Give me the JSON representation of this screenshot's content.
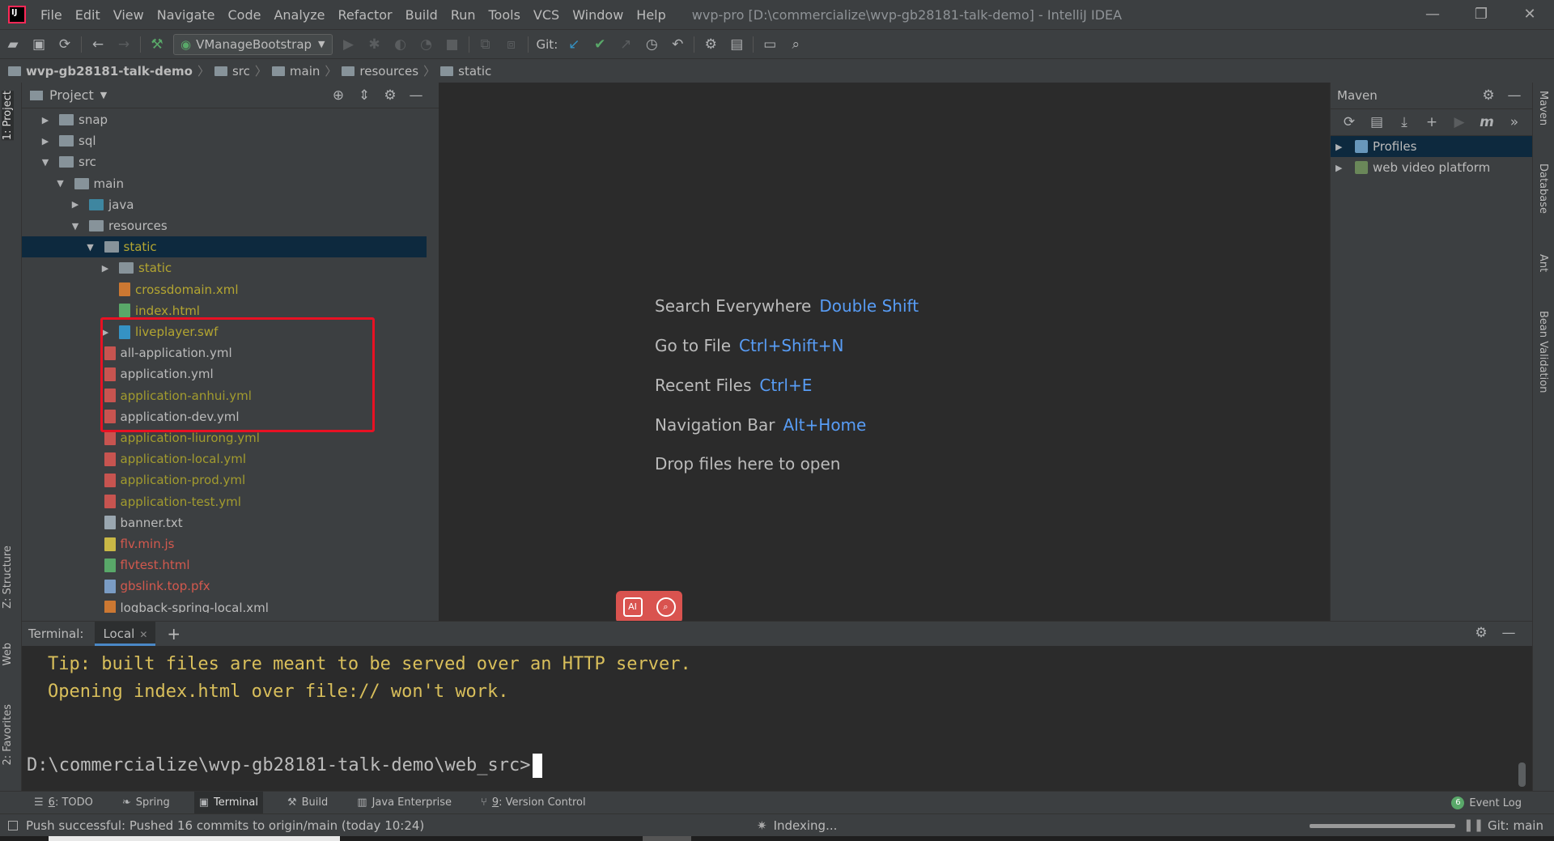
{
  "menubar": {
    "items": [
      "File",
      "Edit",
      "View",
      "Navigate",
      "Code",
      "Analyze",
      "Refactor",
      "Build",
      "Run",
      "Tools",
      "VCS",
      "Window",
      "Help"
    ],
    "title": "wvp-pro [D:\\commercialize\\wvp-gb28181-talk-demo] - IntelliJ IDEA",
    "window_controls": [
      "—",
      "❐",
      "✕"
    ]
  },
  "toolbar": {
    "run_config": "VManageBootstrap",
    "git_label": "Git:"
  },
  "breadcrumb": [
    "wvp-gb28181-talk-demo",
    "src",
    "main",
    "resources",
    "static"
  ],
  "left_strip": {
    "project_tab": "1: Project",
    "structure_tab": "Z: Structure",
    "web_tab": "Web",
    "favorites_tab": "2: Favorites"
  },
  "right_strip": {
    "maven_tab": "Maven",
    "database_tab": "Database",
    "ant_tab": "Ant",
    "bean_tab": "Bean Validation"
  },
  "project_panel": {
    "title": "Project",
    "tree": [
      {
        "label": "snap",
        "type": "folder",
        "depth": 0,
        "arrow": "right",
        "color": "default"
      },
      {
        "label": "sql",
        "type": "folder",
        "depth": 0,
        "arrow": "right",
        "color": "default"
      },
      {
        "label": "src",
        "type": "folder",
        "depth": 0,
        "arrow": "down",
        "color": "default"
      },
      {
        "label": "main",
        "type": "folder",
        "depth": 1,
        "arrow": "down",
        "color": "default"
      },
      {
        "label": "java",
        "type": "folder-blue",
        "depth": 2,
        "arrow": "right",
        "color": "default"
      },
      {
        "label": "resources",
        "type": "folder",
        "depth": 2,
        "arrow": "down",
        "color": "default"
      },
      {
        "label": "static",
        "type": "folder",
        "depth": 3,
        "arrow": "down",
        "color": "yellow",
        "selected": true
      },
      {
        "label": "static",
        "type": "folder",
        "depth": 4,
        "arrow": "right",
        "color": "yellow"
      },
      {
        "label": "crossdomain.xml",
        "type": "xml",
        "depth": 4,
        "arrow": "",
        "color": "yellow"
      },
      {
        "label": "index.html",
        "type": "html",
        "depth": 4,
        "arrow": "",
        "color": "yellow"
      },
      {
        "label": "liveplayer.swf",
        "type": "swf",
        "depth": 4,
        "arrow": "right",
        "color": "yellow"
      },
      {
        "label": "all-application.yml",
        "type": "yml",
        "depth": 3,
        "arrow": "",
        "color": "default"
      },
      {
        "label": "application.yml",
        "type": "yml",
        "depth": 3,
        "arrow": "",
        "color": "default"
      },
      {
        "label": "application-anhui.yml",
        "type": "yml",
        "depth": 3,
        "arrow": "",
        "color": "olive"
      },
      {
        "label": "application-dev.yml",
        "type": "yml",
        "depth": 3,
        "arrow": "",
        "color": "default"
      },
      {
        "label": "application-liurong.yml",
        "type": "yml",
        "depth": 3,
        "arrow": "",
        "color": "olive"
      },
      {
        "label": "application-local.yml",
        "type": "yml",
        "depth": 3,
        "arrow": "",
        "color": "olive"
      },
      {
        "label": "application-prod.yml",
        "type": "yml",
        "depth": 3,
        "arrow": "",
        "color": "olive"
      },
      {
        "label": "application-test.yml",
        "type": "yml",
        "depth": 3,
        "arrow": "",
        "color": "olive"
      },
      {
        "label": "banner.txt",
        "type": "txt",
        "depth": 3,
        "arrow": "",
        "color": "default"
      },
      {
        "label": "flv.min.js",
        "type": "js",
        "depth": 3,
        "arrow": "",
        "color": "red"
      },
      {
        "label": "flvtest.html",
        "type": "html",
        "depth": 3,
        "arrow": "",
        "color": "red"
      },
      {
        "label": "gbslink.top.pfx",
        "type": "pfx",
        "depth": 3,
        "arrow": "",
        "color": "red"
      },
      {
        "label": "logback-spring-local.xml",
        "type": "xml",
        "depth": 3,
        "arrow": "",
        "color": "default"
      }
    ]
  },
  "editor": {
    "hints": [
      {
        "text": "Search Everywhere",
        "key": "Double Shift"
      },
      {
        "text": "Go to File",
        "key": "Ctrl+Shift+N"
      },
      {
        "text": "Recent Files",
        "key": "Ctrl+E"
      },
      {
        "text": "Navigation Bar",
        "key": "Alt+Home"
      },
      {
        "text": "Drop files here to open",
        "key": ""
      }
    ],
    "ai_widget_label": "AI"
  },
  "maven_panel": {
    "title": "Maven",
    "items": [
      {
        "label": "Profiles",
        "selected": true
      },
      {
        "label": "web video platform",
        "selected": false
      }
    ]
  },
  "terminal": {
    "label": "Terminal:",
    "tab": "Local",
    "lines": [
      "Tip: built files are meant to be served over an HTTP server.",
      "Opening index.html over file:// won't work."
    ],
    "prompt": "D:\\commercialize\\wvp-gb28181-talk-demo\\web_src>"
  },
  "tool_tabs": [
    {
      "num": "6",
      "label": ": TODO",
      "icon": "todo-icon"
    },
    {
      "num": "",
      "label": "Spring",
      "icon": "spring-icon"
    },
    {
      "num": "",
      "label": "Terminal",
      "icon": "terminal-icon",
      "active": true
    },
    {
      "num": "",
      "label": "Build",
      "icon": "build-icon"
    },
    {
      "num": "",
      "label": "Java Enterprise",
      "icon": "java-enterprise-icon"
    },
    {
      "num": "9",
      "label": ": Version Control",
      "icon": "version-control-icon"
    }
  ],
  "event_log": {
    "count": "6",
    "label": "Event Log"
  },
  "statusbar": {
    "message": "Push successful: Pushed 16 commits to origin/main (today 10:24)",
    "indexing": "Indexing...",
    "git_branch": "Git: main"
  },
  "colors": {
    "accent_blue": "#589df6",
    "selection": "#0d293e",
    "highlight_box": "#e81123",
    "terminal_text": "#d9bf5b"
  }
}
